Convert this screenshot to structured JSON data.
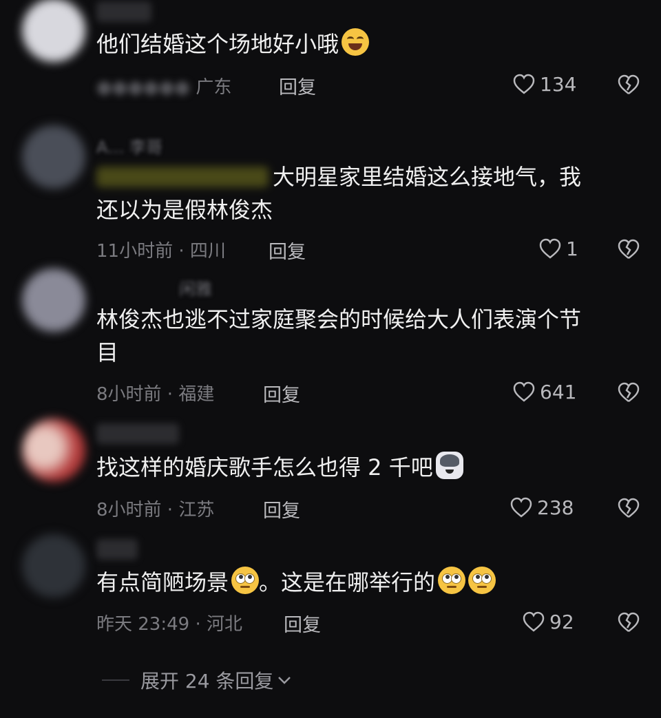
{
  "comments": [
    {
      "text": "他们结婚这个场地好小哦",
      "emoji": "laughing-crying-emoji",
      "location": "广东",
      "reply_label": "回复",
      "likes": "134",
      "avatar_color": "#cfcfd6"
    },
    {
      "name_hint": "A… 李哥",
      "text_line1": "大明星家里结婚这么接地气，我",
      "text_line2": "还以为是假林俊杰",
      "time": "11小时前 · 四川",
      "reply_label": "回复",
      "likes": "1",
      "avatar_color": "#4a4e58"
    },
    {
      "name_hint": "闲雅",
      "text_line1": "林俊杰也逃不过家庭聚会的时候给大人们表演个节",
      "text_line2": "目",
      "time": "8小时前 · 福建",
      "reply_label": "回复",
      "likes": "641",
      "avatar_color": "#8a8a98"
    },
    {
      "text": "找这样的婚庆歌手怎么也得 2 千吧",
      "emoji": "dog-emoji",
      "time": "8小时前 · 江苏",
      "reply_label": "回复",
      "likes": "238",
      "avatar_color": "#b23a3a"
    },
    {
      "text_a": "有点简陋场景",
      "text_b": "。这是在哪举行的",
      "emoji": "eye-roll-emoji",
      "time": "昨天 23:49 · 河北",
      "reply_label": "回复",
      "likes": "92",
      "avatar_color": "#2e3238"
    }
  ],
  "expand_label": "展开 24 条回复"
}
